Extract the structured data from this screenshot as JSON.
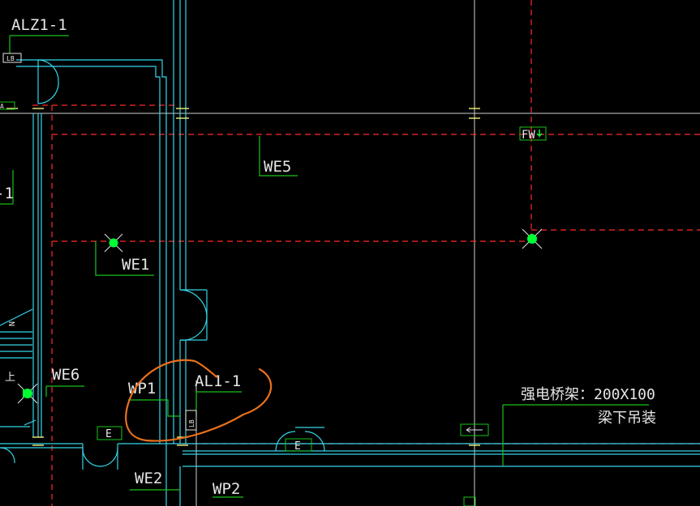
{
  "labels": {
    "alz": "ALZ1-1",
    "lb_top": "LB",
    "a_small": "A",
    "left_cut": "-1",
    "we5": "WE5",
    "fw": "FW",
    "we1": "WE1",
    "we6": "WE6",
    "wp1": "WP1",
    "al": "AL1-1",
    "lb_vert": "LB",
    "e_left": "E",
    "e_mid": "E",
    "we2": "WE2",
    "wp2": "WP2",
    "tray_spec": "强电桥架：200X100",
    "tray_mount": "梁下吊装",
    "stair_up": "上"
  },
  "colors": {
    "background": "#000000",
    "grid_axis": "#d0d0d0",
    "dashed_red": "#ff2a2a",
    "wall_cyan": "#34d6e8",
    "leader_green": "#19c419",
    "fixture_green": "#00ff33",
    "marker_yellow": "#f2ef7a",
    "annotation_orange": "#e8701c",
    "text_white": "#e6e6e6"
  }
}
